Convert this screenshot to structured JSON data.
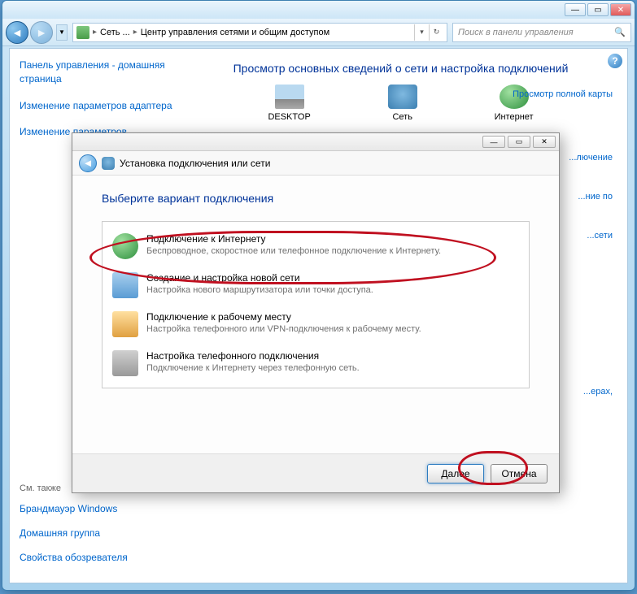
{
  "main_window": {
    "breadcrumb": {
      "part1": "Сеть ...",
      "part2": "Центр управления сетями и общим доступом"
    },
    "search_placeholder": "Поиск в панели управления",
    "help_glyph": "?",
    "heading": "Просмотр основных сведений о сети и настройка подключений",
    "map_link": "Просмотр полной карты",
    "network_items": {
      "desktop": "DESKTOP",
      "network": "Сеть",
      "internet": "Интернет"
    },
    "side_links": {
      "connect": "...лючение",
      "by": "...ние по",
      "net": "...сети",
      "adapters": "...ерах,"
    },
    "sidebar": {
      "link1": "Панель управления - домашняя страница",
      "link2": "Изменение параметров адаптера",
      "link3": "Изменение параметров"
    },
    "sidebar_bottom": {
      "heading": "См. также",
      "link1": "Брандмауэр Windows",
      "link2": "Домашняя группа",
      "link3": "Свойства обозревателя"
    }
  },
  "dialog": {
    "title": "Установка подключения или сети",
    "prompt": "Выберите вариант подключения",
    "options": [
      {
        "title": "Подключение к Интернету",
        "desc": "Беспроводное, скоростное или телефонное подключение к Интернету."
      },
      {
        "title": "Создание и настройка новой сети",
        "desc": "Настройка нового маршрутизатора или точки доступа."
      },
      {
        "title": "Подключение к рабочему месту",
        "desc": "Настройка телефонного или VPN-подключения к рабочему месту."
      },
      {
        "title": "Настройка телефонного подключения",
        "desc": "Подключение к Интернету через телефонную сеть."
      }
    ],
    "buttons": {
      "next": "Далее",
      "cancel": "Отмена"
    }
  }
}
